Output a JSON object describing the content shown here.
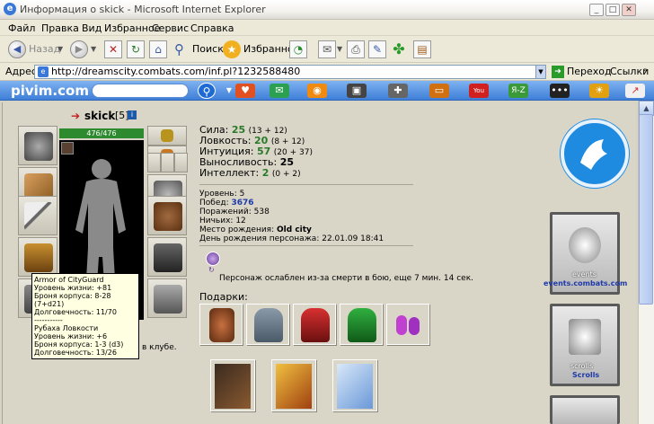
{
  "window": {
    "title": "Информация о skick - Microsoft Internet Explorer"
  },
  "menu": [
    "Файл",
    "Правка",
    "Вид",
    "Избранное",
    "Сервис",
    "Справка"
  ],
  "toolbar": {
    "back": "Назад",
    "search": "Поиск",
    "favorites": "Избранное"
  },
  "address": {
    "label": "Адрес:",
    "url": "http://dreamscity.combats.com/inf.pl?1232588480",
    "go": "Переход",
    "links": "Ссылки"
  },
  "pivim": {
    "logo": "pivim.com"
  },
  "character": {
    "name": "skick",
    "level_badge": "[5]",
    "hp": "476/476",
    "stats": [
      {
        "name": "Сила:",
        "value": "25",
        "detail": "(13 + 12)"
      },
      {
        "name": "Ловкость:",
        "value": "20",
        "detail": "(8 + 12)"
      },
      {
        "name": "Интуиция:",
        "value": "57",
        "detail": "(20 + 37)"
      },
      {
        "name": "Выносливость:",
        "value": "25",
        "detail": ""
      },
      {
        "name": "Интеллект:",
        "value": "2",
        "detail": "(0 + 2)"
      }
    ],
    "info": [
      {
        "label": "Уровень:",
        "value": "5"
      },
      {
        "label": "Побед:",
        "value": "3676"
      },
      {
        "label": "Поражений:",
        "value": "538"
      },
      {
        "label": "Ничьих:",
        "value": "12"
      },
      {
        "label": "Место рождения:",
        "value": "Old city"
      },
      {
        "label": "День рождения персонажа:",
        "value": "22.01.09 18:41"
      }
    ],
    "status": "Персонаж ослаблен из-за смерти в бою, еще 7 мин. 14 сек.",
    "club_text": "в клубе.",
    "gifts_label": "Подарки:"
  },
  "tooltip": [
    "Armor of CityGuard",
    "Уровень жизни: +81",
    "Броня корпуса: 8-28 (7+d21)",
    "Долговечность: 11/70",
    "-----------",
    "Рубаха Ловкости",
    "Уровень жизни: +6",
    "Броня корпуса: 1-3 (d3)",
    "Долговечность: 13/26"
  ],
  "sidebar": {
    "events": "events.combats.com",
    "events_banner": "events",
    "scrolls": "Scrolls",
    "scrolls_banner": "scrolls"
  }
}
